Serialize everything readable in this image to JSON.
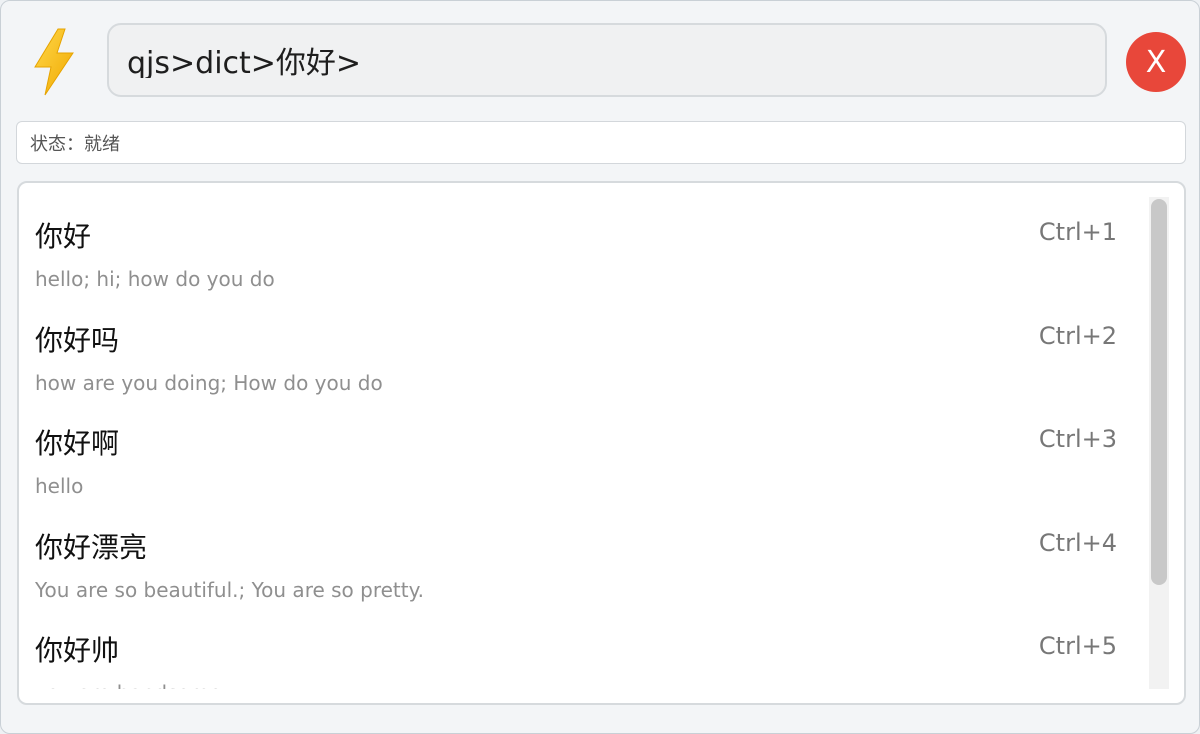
{
  "app": {
    "icon": "lightning-bolt-icon",
    "accent_color": "#e8473a",
    "bolt_color": "#f6c21c"
  },
  "command": {
    "value": "qjs>dict>你好>"
  },
  "close_button": {
    "label": "X"
  },
  "status": {
    "text": "状态：就绪"
  },
  "results": [
    {
      "word": "你好",
      "definition": "hello; hi; how do you do",
      "shortcut": "Ctrl+1"
    },
    {
      "word": "你好吗",
      "definition": "how are you doing; How do you do",
      "shortcut": "Ctrl+2"
    },
    {
      "word": "你好啊",
      "definition": "hello",
      "shortcut": "Ctrl+3"
    },
    {
      "word": "你好漂亮",
      "definition": "You are so beautiful.; You are so pretty.",
      "shortcut": "Ctrl+4"
    },
    {
      "word": "你好帅",
      "definition": "you are handsome",
      "shortcut": "Ctrl+5"
    }
  ],
  "scrollbar": {
    "thumb_fraction": 0.79
  }
}
